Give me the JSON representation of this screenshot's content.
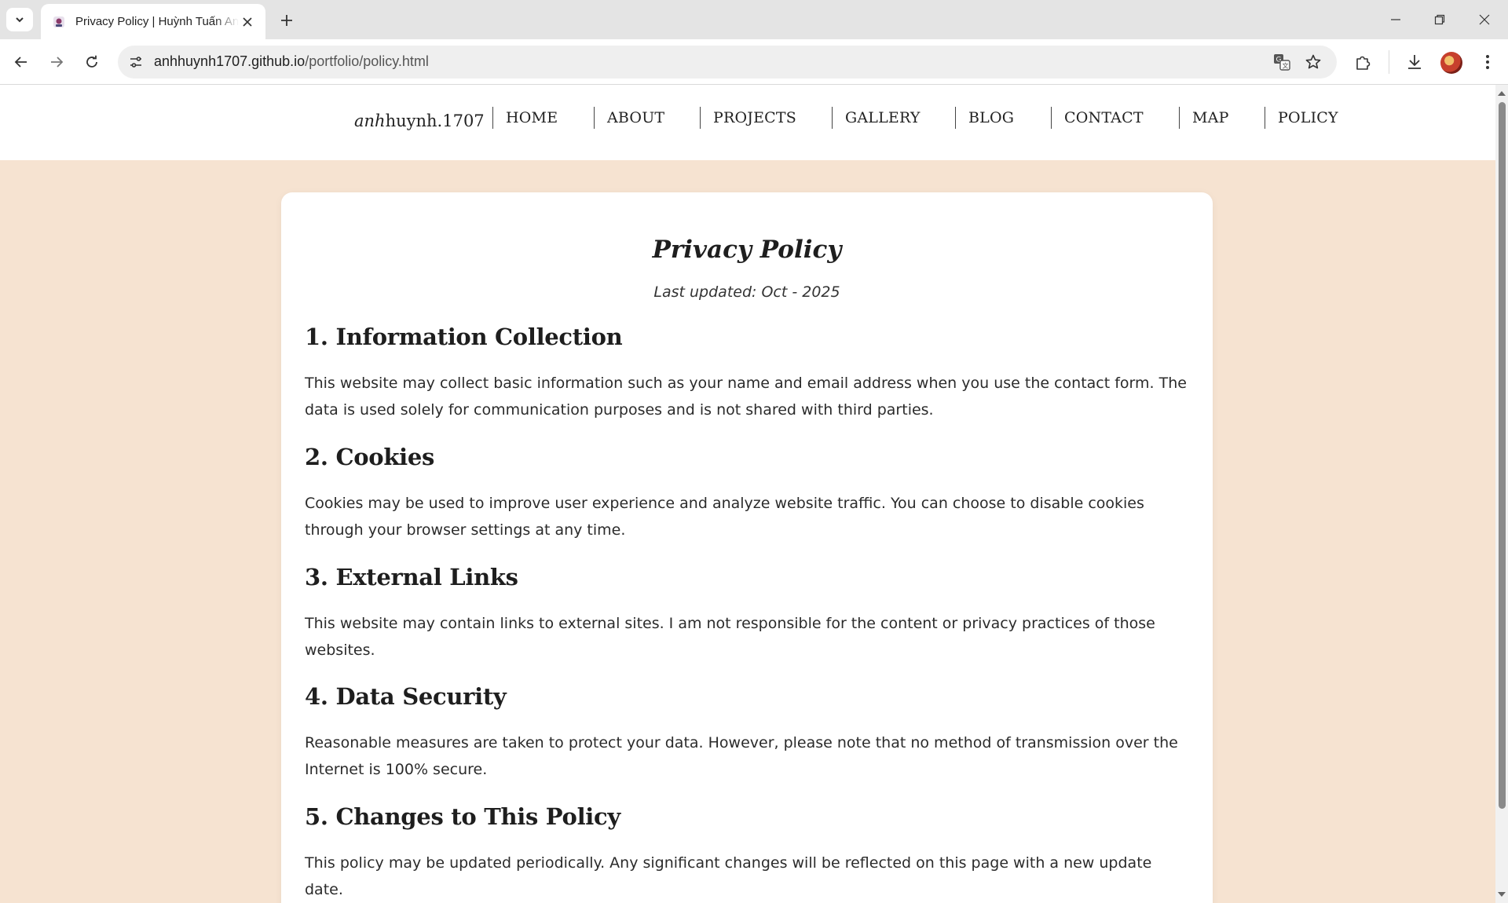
{
  "browser": {
    "tab_title": "Privacy Policy | Huỳnh Tuấn Anh",
    "url_host": "anhhuynh1707.github.io",
    "url_path": "/portfolio/policy.html",
    "icons": {
      "tab_list": "chevron-down-icon",
      "close_tab": "close-icon",
      "new_tab": "plus-icon",
      "back": "arrow-left-icon",
      "forward": "arrow-right-icon",
      "reload": "reload-icon",
      "site_info": "tune-icon",
      "translate": "translate-icon",
      "bookmark": "star-icon",
      "extensions": "puzzle-icon",
      "downloads": "download-icon",
      "menu": "kebab-menu-icon"
    }
  },
  "site": {
    "brand_italic": "anh",
    "brand_rest": "huynh.1707",
    "nav": [
      "HOME",
      "ABOUT",
      "PROJECTS",
      "GALLERY",
      "BLOG",
      "CONTACT",
      "MAP",
      "POLICY"
    ]
  },
  "policy": {
    "title": "Privacy Policy",
    "last_updated": "Last updated: Oct - 2025",
    "sections": [
      {
        "heading": "1. Information Collection",
        "body": "This website may collect basic information such as your name and email address when you use the contact form. The data is used solely for communication purposes and is not shared with third parties."
      },
      {
        "heading": "2. Cookies",
        "body": "Cookies may be used to improve user experience and analyze website traffic. You can choose to disable cookies through your browser settings at any time."
      },
      {
        "heading": "3. External Links",
        "body": "This website may contain links to external sites. I am not responsible for the content or privacy practices of those websites."
      },
      {
        "heading": "4. Data Security",
        "body": "Reasonable measures are taken to protect your data. However, please note that no method of transmission over the Internet is 100% secure."
      },
      {
        "heading": "5. Changes to This Policy",
        "body": "This policy may be updated periodically. Any significant changes will be reflected on this page with a new update date."
      }
    ]
  },
  "colors": {
    "page_background": "#f6e3d1",
    "card": "#ffffff",
    "text": "#1e1e1e"
  }
}
